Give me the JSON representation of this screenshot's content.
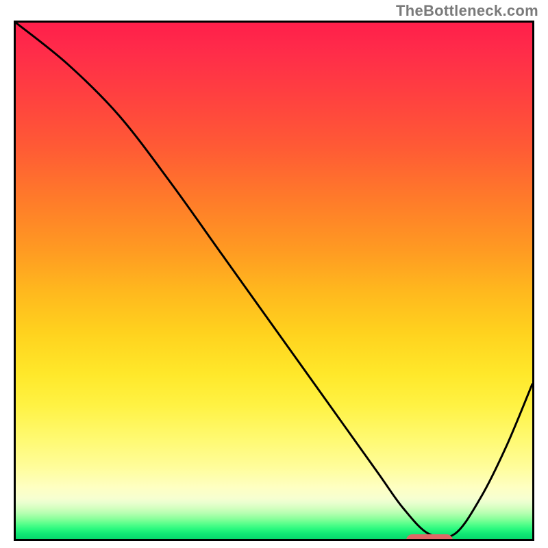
{
  "watermark": "TheBottleneck.com",
  "chart_data": {
    "type": "line",
    "title": "",
    "xlabel": "",
    "ylabel": "",
    "xlim": [
      0,
      100
    ],
    "ylim": [
      0,
      100
    ],
    "grid": false,
    "legend": false,
    "background": "red-yellow-green vertical gradient",
    "series": [
      {
        "name": "bottleneck-curve",
        "x": [
          0,
          10,
          20,
          30,
          40,
          50,
          60,
          70,
          75,
          80,
          85,
          90,
          95,
          100
        ],
        "values": [
          100,
          92,
          82,
          69,
          55,
          41,
          27,
          13,
          6,
          1,
          1,
          8,
          18,
          30
        ]
      }
    ],
    "optimal_marker": {
      "x_start": 75,
      "x_end": 84,
      "y": 0.5
    },
    "colors": {
      "curve": "#000000",
      "marker": "#e06666",
      "border": "#000000"
    }
  }
}
